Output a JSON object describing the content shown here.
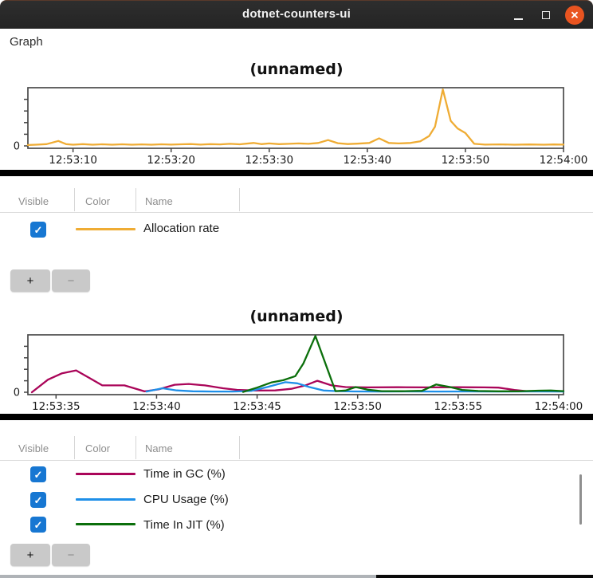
{
  "window": {
    "title": "dotnet-counters-ui"
  },
  "graph_label": "Graph",
  "icons": {
    "check": "✓",
    "close": "✕"
  },
  "colors": {
    "checkbox_blue": "#1777D2",
    "close_button": "#E95420",
    "allocation_orange": "#EFAC34",
    "gc_crimson": "#AA0559",
    "cpu_blue": "#1E8FE8",
    "jit_green": "#0B6F0B"
  },
  "chart_data": [
    {
      "type": "line",
      "title": "(unnamed)",
      "xlabel": "",
      "ylabel": "",
      "x_unit": "seconds after 12:53:00",
      "y_unit": "fraction of plot height (only 0 labeled on axis)",
      "xlim": [
        5.4,
        60
      ],
      "ylim": [
        0,
        1
      ],
      "zero_label": "0",
      "grid": false,
      "xticks": [
        {
          "x": 10,
          "label": "12:53:10"
        },
        {
          "x": 20,
          "label": "12:53:20"
        },
        {
          "x": 30,
          "label": "12:53:30"
        },
        {
          "x": 40,
          "label": "12:53:40"
        },
        {
          "x": 50,
          "label": "12:53:50"
        },
        {
          "x": 60,
          "label": "12:54:00"
        }
      ],
      "series": [
        {
          "name": "Allocation rate",
          "color": "#EFAC34",
          "points": [
            [
              5.4,
              0.015
            ],
            [
              6.2,
              0.02
            ],
            [
              7.3,
              0.03
            ],
            [
              8.5,
              0.085
            ],
            [
              9.3,
              0.03
            ],
            [
              10,
              0.02
            ],
            [
              11,
              0.03
            ],
            [
              12,
              0.02
            ],
            [
              13,
              0.027
            ],
            [
              14,
              0.02
            ],
            [
              15,
              0.028
            ],
            [
              16,
              0.02
            ],
            [
              17,
              0.026
            ],
            [
              18,
              0.02
            ],
            [
              19,
              0.028
            ],
            [
              20,
              0.022
            ],
            [
              21,
              0.027
            ],
            [
              22,
              0.032
            ],
            [
              23,
              0.022
            ],
            [
              24,
              0.03
            ],
            [
              25,
              0.026
            ],
            [
              26,
              0.035
            ],
            [
              27,
              0.027
            ],
            [
              28.4,
              0.05
            ],
            [
              29.2,
              0.03
            ],
            [
              30,
              0.042
            ],
            [
              31,
              0.03
            ],
            [
              32,
              0.036
            ],
            [
              33,
              0.042
            ],
            [
              34,
              0.036
            ],
            [
              35,
              0.05
            ],
            [
              36,
              0.1
            ],
            [
              37,
              0.046
            ],
            [
              38,
              0.032
            ],
            [
              39,
              0.038
            ],
            [
              40.2,
              0.05
            ],
            [
              41.2,
              0.13
            ],
            [
              42.2,
              0.05
            ],
            [
              43.2,
              0.042
            ],
            [
              44.4,
              0.05
            ],
            [
              45.4,
              0.08
            ],
            [
              46.3,
              0.17
            ],
            [
              46.9,
              0.33
            ],
            [
              47.7,
              0.97
            ],
            [
              48.5,
              0.43
            ],
            [
              49.2,
              0.3
            ],
            [
              50,
              0.22
            ],
            [
              50.9,
              0.035
            ],
            [
              52,
              0.022
            ],
            [
              53.5,
              0.026
            ],
            [
              55,
              0.02
            ],
            [
              56.5,
              0.024
            ],
            [
              58,
              0.02
            ],
            [
              59,
              0.024
            ],
            [
              60,
              0.022
            ]
          ]
        }
      ]
    },
    {
      "type": "line",
      "title": "(unnamed)",
      "xlabel": "",
      "ylabel": "",
      "x_unit": "seconds after 12:53:00",
      "y_unit": "fraction of plot height (only 0 labeled on axis)",
      "xlim": [
        33.6,
        60.24
      ],
      "ylim": [
        0,
        1
      ],
      "zero_label": "0",
      "grid": false,
      "xticks": [
        {
          "x": 35,
          "label": "12:53:35"
        },
        {
          "x": 40,
          "label": "12:53:40"
        },
        {
          "x": 45,
          "label": "12:53:45"
        },
        {
          "x": 50,
          "label": "12:53:50"
        },
        {
          "x": 55,
          "label": "12:53:55"
        },
        {
          "x": 60,
          "label": "12:54:00"
        }
      ],
      "series": [
        {
          "name": "Time in GC (%)",
          "color": "#AA0559",
          "points": [
            [
              33.8,
              0.0
            ],
            [
              34.6,
              0.22
            ],
            [
              35.3,
              0.33
            ],
            [
              36.0,
              0.38
            ],
            [
              36.6,
              0.26
            ],
            [
              37.3,
              0.12
            ],
            [
              38.4,
              0.12
            ],
            [
              39.4,
              0.015
            ],
            [
              40.1,
              0.05
            ],
            [
              40.9,
              0.13
            ],
            [
              41.6,
              0.145
            ],
            [
              42.4,
              0.12
            ],
            [
              43.3,
              0.07
            ],
            [
              44.0,
              0.042
            ],
            [
              44.9,
              0.03
            ],
            [
              45.9,
              0.032
            ],
            [
              46.7,
              0.06
            ],
            [
              47.4,
              0.12
            ],
            [
              48.0,
              0.2
            ],
            [
              48.7,
              0.12
            ],
            [
              49.4,
              0.09
            ],
            [
              50.5,
              0.085
            ],
            [
              52,
              0.087
            ],
            [
              53.5,
              0.085
            ],
            [
              55,
              0.087
            ],
            [
              56.3,
              0.085
            ],
            [
              57.0,
              0.08
            ],
            [
              57.8,
              0.04
            ],
            [
              58.4,
              0.02
            ],
            [
              59.2,
              0.016
            ],
            [
              60.24,
              0.016
            ]
          ]
        },
        {
          "name": "CPU Usage (%)",
          "color": "#1E8FE8",
          "points": [
            [
              39.5,
              0.012
            ],
            [
              40.3,
              0.07
            ],
            [
              41.0,
              0.032
            ],
            [
              41.8,
              0.016
            ],
            [
              42.8,
              0.012
            ],
            [
              43.8,
              0.012
            ],
            [
              44.7,
              0.022
            ],
            [
              45.5,
              0.09
            ],
            [
              46.4,
              0.175
            ],
            [
              47.0,
              0.155
            ],
            [
              47.6,
              0.09
            ],
            [
              48.3,
              0.03
            ],
            [
              49.0,
              0.02
            ],
            [
              49.8,
              0.014
            ],
            [
              51,
              0.012
            ],
            [
              52.5,
              0.014
            ],
            [
              54,
              0.012
            ],
            [
              55.5,
              0.014
            ],
            [
              57,
              0.012
            ],
            [
              58.5,
              0.014
            ],
            [
              60.24,
              0.012
            ]
          ]
        },
        {
          "name": "Time In JIT (%)",
          "color": "#0B6F0B",
          "points": [
            [
              44.3,
              0.005
            ],
            [
              45.0,
              0.08
            ],
            [
              45.7,
              0.17
            ],
            [
              46.3,
              0.21
            ],
            [
              46.9,
              0.28
            ],
            [
              47.3,
              0.5
            ],
            [
              47.9,
              0.98
            ],
            [
              48.5,
              0.4
            ],
            [
              48.9,
              0.02
            ],
            [
              49.4,
              0.03
            ],
            [
              49.9,
              0.09
            ],
            [
              50.5,
              0.045
            ],
            [
              51.2,
              0.02
            ],
            [
              52.2,
              0.018
            ],
            [
              53.2,
              0.025
            ],
            [
              53.9,
              0.135
            ],
            [
              54.6,
              0.09
            ],
            [
              55.2,
              0.04
            ],
            [
              56.0,
              0.022
            ],
            [
              57.0,
              0.016
            ],
            [
              58.0,
              0.016
            ],
            [
              59.0,
              0.028
            ],
            [
              59.6,
              0.03
            ],
            [
              60.24,
              0.02
            ]
          ]
        }
      ]
    }
  ],
  "legends": [
    {
      "headers": [
        "Visible",
        "Color",
        "Name"
      ],
      "rows": [
        {
          "visible": true,
          "color": "#EFAC34",
          "name": "Allocation rate"
        }
      ],
      "add_label": "+",
      "remove_label": "−"
    },
    {
      "headers": [
        "Visible",
        "Color",
        "Name"
      ],
      "rows": [
        {
          "visible": true,
          "color": "#AA0559",
          "name": "Time in GC (%)"
        },
        {
          "visible": true,
          "color": "#1E8FE8",
          "name": "CPU Usage (%)"
        },
        {
          "visible": true,
          "color": "#0B6F0B",
          "name": "Time In JIT (%)"
        }
      ],
      "add_label": "+",
      "remove_label": "−"
    }
  ]
}
